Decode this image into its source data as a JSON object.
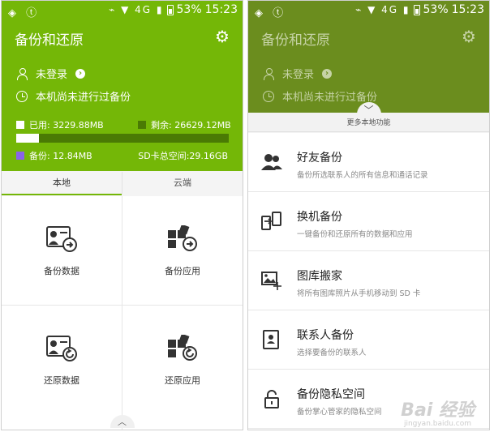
{
  "status": {
    "battery": "53%",
    "time": "15:23"
  },
  "app": {
    "title": "备份和还原"
  },
  "account": {
    "login_text": "未登录",
    "backup_status": "本机尚未进行过备份"
  },
  "storage": {
    "used_label": "已用: 3229.88MB",
    "free_label": "剩余: 26629.12MB",
    "backup_label": "备份: 12.84MB",
    "sd_total_label": "SD卡总空间:29.16GB",
    "used_fraction": 0.108,
    "colors": {
      "used": "#ffffff",
      "free": "#4a7a04",
      "backup": "#8a63e8"
    }
  },
  "tabs": [
    {
      "label": "本地"
    },
    {
      "label": "云端"
    }
  ],
  "actions": [
    {
      "label": "备份数据",
      "icon": "contact-card-arrow-icon"
    },
    {
      "label": "备份应用",
      "icon": "apps-arrow-icon"
    },
    {
      "label": "还原数据",
      "icon": "contact-card-restore-icon"
    },
    {
      "label": "还原应用",
      "icon": "apps-restore-icon"
    }
  ],
  "sheet": {
    "header": "更多本地功能",
    "items": [
      {
        "title": "好友备份",
        "desc": "备份所选联系人的所有信息和通话记录",
        "icon": "people-icon"
      },
      {
        "title": "换机备份",
        "desc": "一键备份和还原所有的数据和应用",
        "icon": "phone-transfer-icon"
      },
      {
        "title": "图库搬家",
        "desc": "将所有图库照片从手机移动到 SD 卡",
        "icon": "gallery-move-icon"
      },
      {
        "title": "联系人备份",
        "desc": "选择要备份的联系人",
        "icon": "contact-book-icon"
      },
      {
        "title": "备份隐私空间",
        "desc": "备份掌心管家的隐私空间",
        "icon": "lock-icon"
      }
    ]
  },
  "watermark": {
    "main": "Bai 经验",
    "url": "jingyan.baidu.com"
  },
  "colors": {
    "accent": "#74b707",
    "dimmed_accent": "#6b8d1e"
  }
}
